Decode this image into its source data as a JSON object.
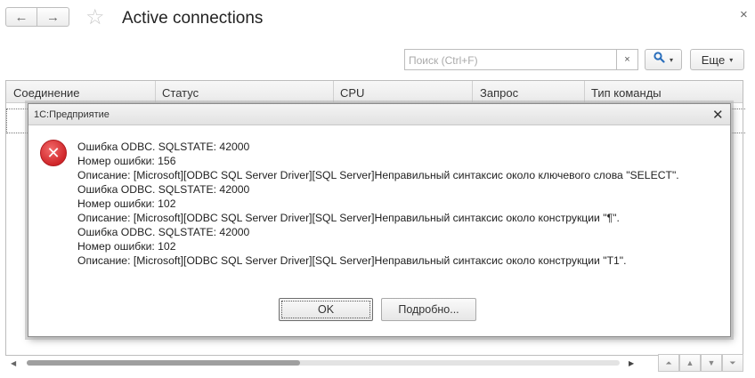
{
  "window": {
    "title": "Active connections",
    "close_glyph": "×"
  },
  "nav": {
    "back_glyph": "←",
    "forward_glyph": "→",
    "favorite_glyph": "☆"
  },
  "toolbar": {
    "search_placeholder": "Поиск (Ctrl+F)",
    "search_clear_glyph": "×",
    "more_label": "Еще",
    "caret_glyph": "▾"
  },
  "table": {
    "columns": [
      "Соединение",
      "Статус",
      "CPU",
      "Запрос",
      "Тип команды"
    ]
  },
  "pager": {
    "first_glyph": "⏶",
    "prev_glyph": "▲",
    "next_glyph": "▼",
    "last_glyph": "⏷"
  },
  "scroll": {
    "left_glyph": "◀",
    "right_glyph": "▶"
  },
  "dialog": {
    "title": "1С:Предприятие",
    "close_glyph": "✕",
    "icon_glyph": "✕",
    "lines": [
      "Ошибка ODBC. SQLSTATE: 42000",
      "Номер ошибки: 156",
      "Описание: [Microsoft][ODBC SQL Server Driver][SQL Server]Неправильный синтаксис около ключевого слова \"SELECT\".",
      "Ошибка ODBC. SQLSTATE: 42000",
      "Номер ошибки: 102",
      "Описание: [Microsoft][ODBC SQL Server Driver][SQL Server]Неправильный синтаксис около конструкции \"¶\".",
      "Ошибка ODBC. SQLSTATE: 42000",
      "Номер ошибки: 102",
      "Описание: [Microsoft][ODBC SQL Server Driver][SQL Server]Неправильный синтаксис около конструкции \"T1\"."
    ],
    "ok_label": "OK",
    "details_label": "Подробно..."
  },
  "colors": {
    "error_red": "#d0262a",
    "border_gray": "#bdbdbd"
  },
  "icons": [
    "back-arrow-icon",
    "forward-arrow-icon",
    "star-icon",
    "close-icon",
    "search-icon",
    "chevron-down-icon",
    "error-icon"
  ]
}
